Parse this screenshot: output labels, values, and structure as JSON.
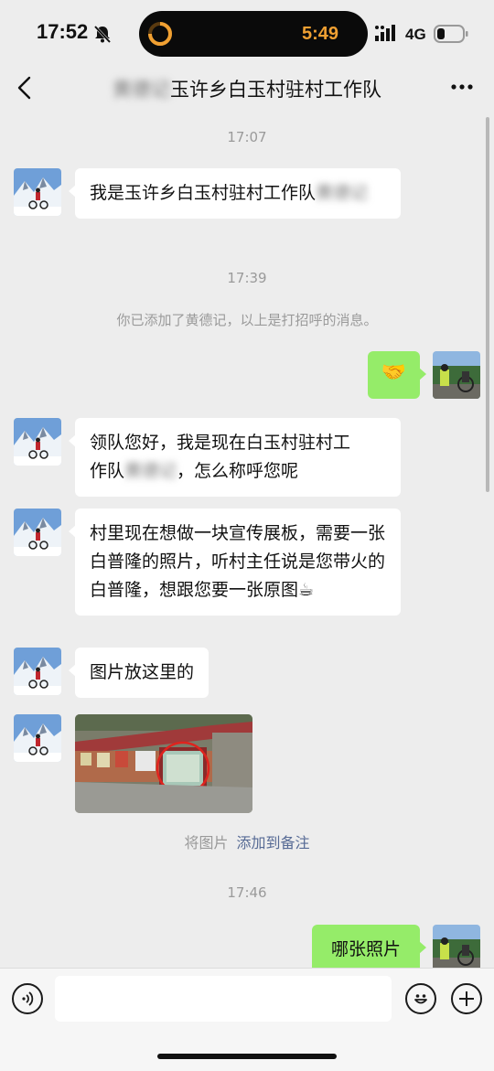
{
  "status_bar": {
    "time": "17:52",
    "timer": "5:49",
    "network": "4G"
  },
  "nav": {
    "title_blurred": "黄德记",
    "title": "玉许乡白玉村驻村工作队"
  },
  "timestamps": [
    "17:07",
    "17:39",
    "17:46"
  ],
  "messages": [
    {
      "text": "我是玉许乡白玉村驻村工作队",
      "blurred": "黄德记"
    },
    {
      "emoji": "🤝"
    },
    {
      "text_a": "领队您好，我是现在白玉村驻村工",
      "text_b_pre": "作队",
      "blurred": "黄德记",
      "text_b_post": "，怎么称呼您呢"
    },
    {
      "text": "村里现在想做一块宣传展板，需要一张白普隆的照片，听村主任说是您带火的白普隆，想跟您要一张原图☕"
    },
    {
      "text": "图片放这里的"
    },
    {
      "text": "哪张照片"
    }
  ],
  "system": {
    "added_note": "你已添加了黄德记，以上是打招呼的消息。"
  },
  "image_note": {
    "label": "将图片",
    "link": "添加到备注"
  },
  "input": {
    "placeholder": "",
    "value": ""
  }
}
